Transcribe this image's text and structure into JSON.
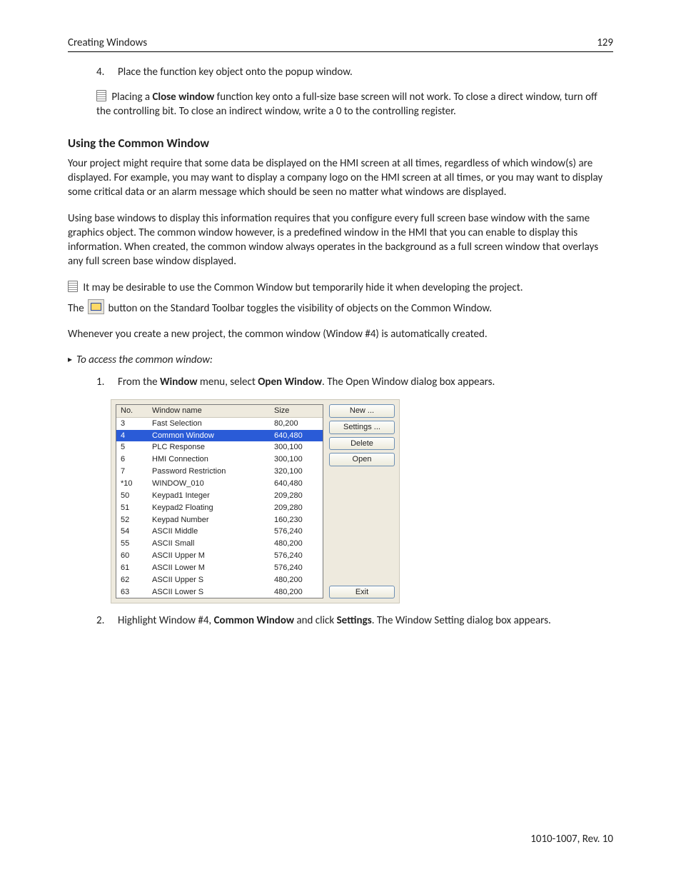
{
  "header": {
    "left": "Creating Windows",
    "right": "129"
  },
  "step4": {
    "num": "4.",
    "text": "Place the function key object onto the popup window."
  },
  "note1": {
    "pre": "Placing a ",
    "bold": "Close window",
    "post": " function key onto a full-size base screen will not work. To close a direct window, turn off the controlling bit. To close an indirect window, write a 0 to the controlling register."
  },
  "section_title": "Using the Common Window",
  "para1": "Your project might require that some data be displayed on the HMI screen at all times, regardless of which window(s) are displayed. For example, you may want to display a company logo on the HMI screen at all times, or you may want to display some critical data or an alarm message which should be seen no matter what windows are displayed.",
  "para2": "Using base windows to display this information requires that you configure every full screen base window with the same graphics object. The common window however, is a predefined window in the HMI that you can enable to display this information. When created, the common window always operates in the background as a full screen window that overlays any full screen base window displayed.",
  "tip": {
    "line1": "It may be desirable to use the Common Window but temporarily hide it when developing the project.",
    "line2a": "The ",
    "line2b": " button on the Standard Toolbar toggles the visibility of objects on the Common Window."
  },
  "para3": "Whenever you create a new project, the common window (Window #4) is automatically created.",
  "access_title": "To access the common window:",
  "step1": {
    "num": "1.",
    "a": "From the ",
    "b": "Window",
    "c": " menu, select ",
    "d": "Open Window",
    "e": ". The Open Window dialog box appears."
  },
  "dialog": {
    "headers": {
      "no": "No.",
      "name": "Window name",
      "size": "Size"
    },
    "rows": [
      {
        "no": "3",
        "name": "Fast Selection",
        "size": "80,200",
        "sel": false
      },
      {
        "no": "4",
        "name": "Common Window",
        "size": "640,480",
        "sel": true
      },
      {
        "no": "5",
        "name": "PLC Response",
        "size": "300,100",
        "sel": false
      },
      {
        "no": "6",
        "name": "HMI Connection",
        "size": "300,100",
        "sel": false
      },
      {
        "no": "7",
        "name": "Password Restriction",
        "size": "320,100",
        "sel": false
      },
      {
        "no": "*10",
        "name": "WINDOW_010",
        "size": "640,480",
        "sel": false
      },
      {
        "no": "50",
        "name": "Keypad1 Integer",
        "size": "209,280",
        "sel": false
      },
      {
        "no": "51",
        "name": "Keypad2 Floating",
        "size": "209,280",
        "sel": false
      },
      {
        "no": "52",
        "name": "Keypad Number",
        "size": "160,230",
        "sel": false
      },
      {
        "no": "54",
        "name": "ASCII Middle",
        "size": "576,240",
        "sel": false
      },
      {
        "no": "55",
        "name": "ASCII Small",
        "size": "480,200",
        "sel": false
      },
      {
        "no": "60",
        "name": "ASCII Upper M",
        "size": "576,240",
        "sel": false
      },
      {
        "no": "61",
        "name": "ASCII Lower M",
        "size": "576,240",
        "sel": false
      },
      {
        "no": "62",
        "name": "ASCII Upper S",
        "size": "480,200",
        "sel": false
      },
      {
        "no": "63",
        "name": "ASCII Lower S",
        "size": "480,200",
        "sel": false
      }
    ],
    "buttons": {
      "new": "New ...",
      "settings": "Settings ...",
      "delete": "Delete",
      "open": "Open",
      "exit": "Exit"
    }
  },
  "step2": {
    "num": "2.",
    "a": "Highlight Window #4, ",
    "b": "Common Window",
    "c": " and click ",
    "d": "Settings",
    "e": ". The Window Setting dialog box appears."
  },
  "footer": "1010-1007, Rev. 10"
}
